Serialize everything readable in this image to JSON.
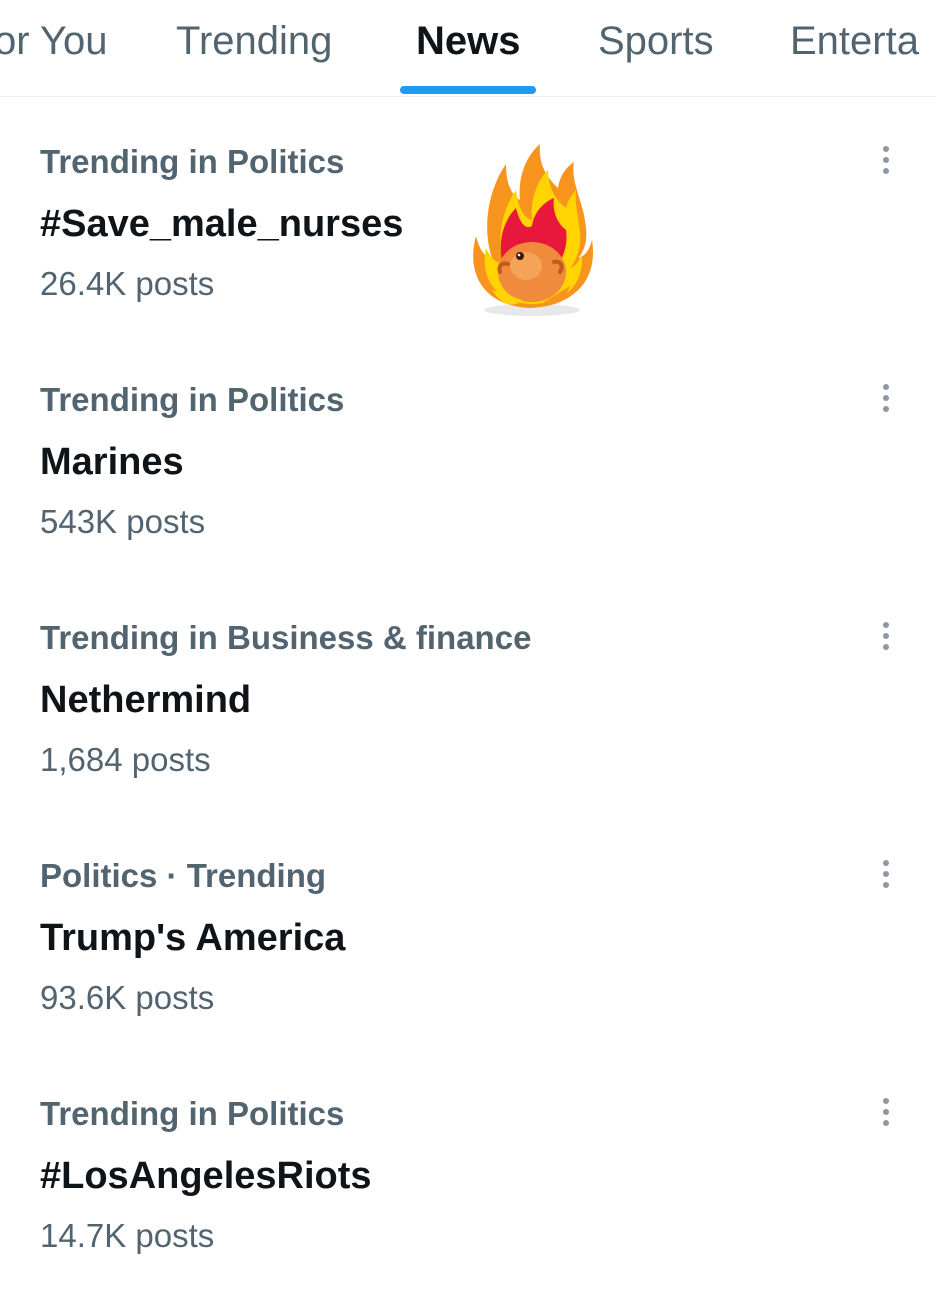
{
  "tabs": [
    {
      "label": "or You",
      "active": false
    },
    {
      "label": "Trending",
      "active": false
    },
    {
      "label": "News",
      "active": true
    },
    {
      "label": "Sports",
      "active": false
    },
    {
      "label": "Enterta",
      "active": false
    }
  ],
  "accent_color": "#1d9bf0",
  "trends": [
    {
      "context": "Trending in Politics",
      "title": "#Save_male_nurses",
      "count": "26.4K posts"
    },
    {
      "context": "Trending in Politics",
      "title": "Marines",
      "count": "543K posts"
    },
    {
      "context": "Trending in Business & finance",
      "title": "Nethermind",
      "count": "1,684 posts"
    },
    {
      "context": "Politics · Trending",
      "title": "Trump's America",
      "count": "93.6K posts"
    },
    {
      "context": "Trending in Politics",
      "title": "#LosAngelesRiots",
      "count": "14.7K posts"
    }
  ],
  "icons": {
    "more": "more-vertical-icon",
    "sticker": "fire-creature-sticker-icon"
  }
}
